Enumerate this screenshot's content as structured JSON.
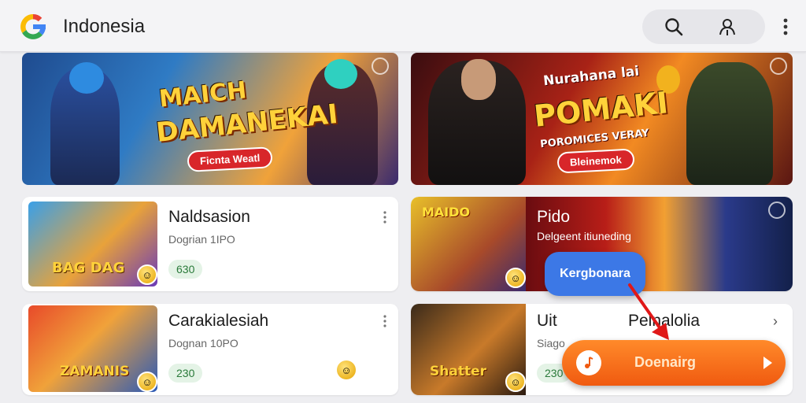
{
  "header": {
    "title": "Indonesia",
    "logo_icon": "google-g-icon",
    "search_icon": "search-icon",
    "account_icon": "account-icon",
    "more_icon": "more-vert-icon"
  },
  "banners": [
    {
      "headline_line1": "MAICH",
      "headline_line2": "DAMANEKAI",
      "pill": "Ficnta Weatl"
    },
    {
      "overline": "Nurahana lai",
      "headline": "POMAKI",
      "tagline": "POROMICES VERAY",
      "pill": "Bleinemok"
    }
  ],
  "cards": [
    {
      "title": "Naldsasion",
      "subtitle": "Dogrian 1IPO",
      "price": "630",
      "thumb_text": "BAG DAG"
    },
    {
      "title": "Pido",
      "subtitle": "Delgeent itiuneding",
      "price": "",
      "thumb_text": "MAIDO"
    },
    {
      "title": "Carakialesiah",
      "subtitle": "Dognan 10PO",
      "price": "230",
      "thumb_text": "ZAMANIS"
    },
    {
      "title": "Uit",
      "title_right": "Pelnalolia",
      "subtitle": "Siago",
      "price": "230",
      "thumb_text": "Shatter"
    }
  ],
  "tooltip": {
    "label": "Kergbonara"
  },
  "cta": {
    "label": "Doenairg"
  },
  "colors": {
    "accent_blue": "#3c78e6",
    "cta_orange": "#f36a14",
    "price_green": "#2a7a3a",
    "pointer_red": "#e01818"
  }
}
